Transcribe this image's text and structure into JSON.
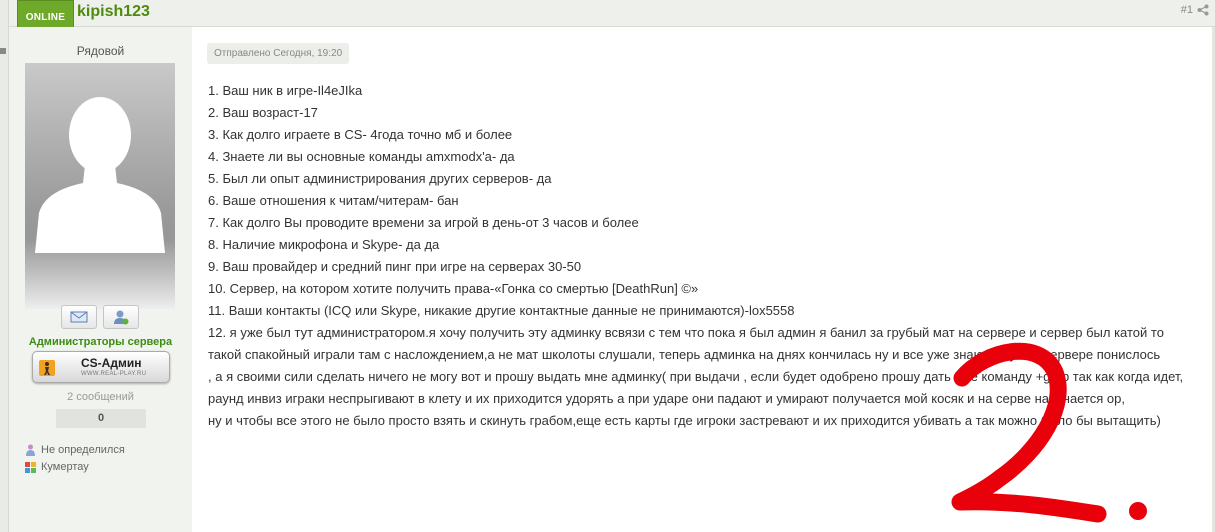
{
  "header": {
    "online_label": "ONLINE",
    "username": "kipish123",
    "post_number": "#1"
  },
  "sidebar": {
    "rank": "Рядовой",
    "group_name": "Администраторы сервера",
    "group_badge_title": "CS-Админ",
    "group_badge_subtitle": "WWW.REAL-PLAY.RU",
    "posts_count": "2 сообщений",
    "reputation": "0",
    "gender": "Не определился",
    "city": "Кумертау"
  },
  "post": {
    "posted": "Отправлено Сегодня, 19:20",
    "lines": [
      "1. Ваш ник в игре-Il4eJIka",
      "2. Ваш возраст-17",
      "3. Как долго играете в CS- 4года точно мб и более",
      "4. Знаете ли вы основные команды amxmodx'a- да",
      "5. Был ли опыт администрирования других серверов- да",
      "6. Ваше отношения к читам/читерам- бан",
      "7. Как долго Вы проводите времени за игрой в день-от 3 часов и более",
      "8. Наличие микрофона и Skype- да да",
      "9. Ваш провайдер и средний пинг при игре на серверах 30-50",
      "10. Сервер, на котором хотите получить права-«Гонка со смертью [DeathRun] ©»",
      "11. Ваши контакты (ICQ или Skype, никакие другие контактные данные не принимаются)-lox5558",
      "12. я уже был тут администратором.я хочу получить эту админку всвязи с тем что пока я был админ я банил за грубый мат на сервере и сервер был катой то такой спакойный играли там с наслождением,а не мат школоты слушали, теперь админка на днях кончилась ну и все уже знают и тут на сервере понислось",
      ", а я своими сили сделать ничего не могу вот и прошу выдать мне админку( при выдачи , если будет одобрено прошу дать мне команду +grab так как когда идет,",
      "раунд инвиз играки неспрыгивают в клету и их приходится удорять а при ударе они падают и умирают получается мой косяк и на серве начинается ор,",
      "ну и чтобы все этого не было просто взять и скинуть грабом,еще есть карты где игроки застревают и их приходится убивать а так можно было бы вытащить)"
    ]
  },
  "colors": {
    "accent_green": "#4f8a10",
    "online_badge": "#6fa92a",
    "annotation_red": "#e8000a"
  }
}
